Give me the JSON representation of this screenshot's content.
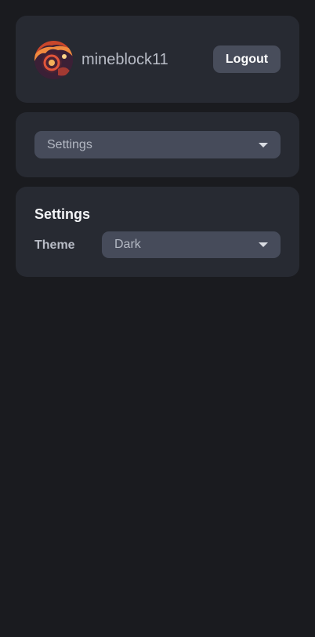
{
  "profile": {
    "username": "mineblock11",
    "logout_label": "Logout",
    "avatar_icon": "avatar-icon"
  },
  "navigation": {
    "selected_page": "Settings",
    "caret_icon": "chevron-down-icon"
  },
  "settings": {
    "title": "Settings",
    "theme_label": "Theme",
    "theme_value": "Dark"
  },
  "colors": {
    "background": "#1a1b1f",
    "card": "#272a32",
    "select": "#464b5a",
    "button": "#484d5b"
  }
}
